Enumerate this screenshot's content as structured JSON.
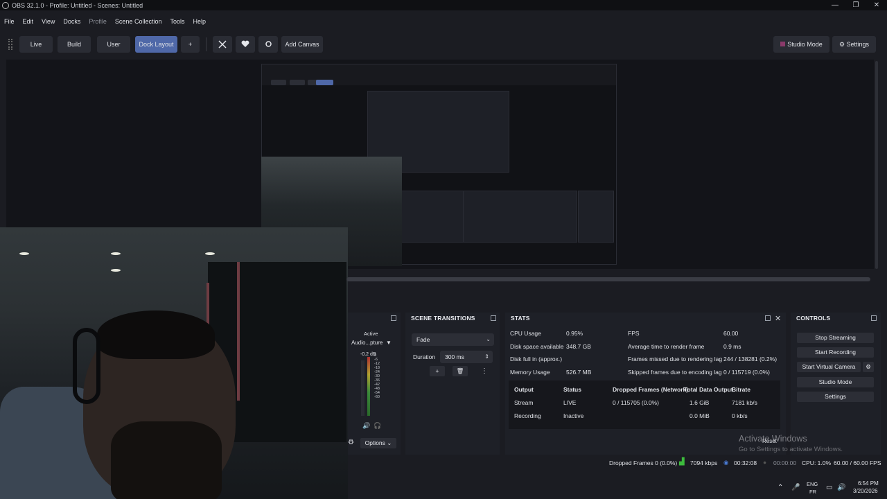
{
  "window": {
    "title": "OBS 32.1.0 - Profile: Untitled - Scenes: Untitled",
    "min": "—",
    "max": "❐",
    "close": "✕"
  },
  "menu": [
    "File",
    "Edit",
    "View",
    "Docks",
    "Profile",
    "Scene Collection",
    "Tools",
    "Help"
  ],
  "toolbar": {
    "live": "Live",
    "build": "Build",
    "user": "User",
    "dock_layout": "Dock Layout",
    "plus": "+",
    "add_canvas": "Add Canvas",
    "studio_mode": "Studio Mode",
    "settings": "Settings"
  },
  "mixer": {
    "active": "Active",
    "source": "Audio...pture",
    "db": "-0.2 dB",
    "ticks": [
      "0",
      "-6",
      "-12",
      "-18",
      "-24",
      "-30",
      "-36",
      "-42",
      "-48",
      "-54",
      "-60"
    ],
    "options": "Options"
  },
  "transitions": {
    "header": "SCENE TRANSITIONS",
    "type": "Fade",
    "duration_label": "Duration",
    "duration": "300 ms"
  },
  "stats": {
    "header": "STATS",
    "left": [
      {
        "label": "CPU Usage",
        "value": "0.95%"
      },
      {
        "label": "Disk space available",
        "value": "348.7 GB"
      },
      {
        "label": "Disk full in (approx.)",
        "value": ""
      },
      {
        "label": "Memory Usage",
        "value": "526.7 MB"
      }
    ],
    "right": [
      {
        "label": "FPS",
        "value": "60.00"
      },
      {
        "label": "Average time to render frame",
        "value": "0.9 ms"
      },
      {
        "label": "Frames missed due to rendering lag",
        "value": "244 / 138281 (0.2%)"
      },
      {
        "label": "Skipped frames due to encoding lag",
        "value": "0 / 115719 (0.0%)"
      }
    ],
    "table_headers": [
      "Output",
      "Status",
      "Dropped Frames (Network)",
      "Total Data Output",
      "Bitrate"
    ],
    "rows": [
      [
        "Stream",
        "LIVE",
        "0 / 115705 (0.0%)",
        "1.6 GiB",
        "7181 kb/s"
      ],
      [
        "Recording",
        "Inactive",
        "",
        "0.0 MiB",
        "0 kb/s"
      ]
    ],
    "reset": "Reset"
  },
  "controls": {
    "header": "CONTROLS",
    "stop_streaming": "Stop Streaming",
    "start_recording": "Start Recording",
    "start_virtual_camera": "Start Virtual Camera",
    "studio_mode": "Studio Mode",
    "settings": "Settings"
  },
  "statusbar": {
    "dropped": "Dropped Frames 0 (0.0%)",
    "kbps": "7094 kbps",
    "live_time": "00:32:08",
    "rec_time": "00:00:00",
    "cpu": "CPU: 1.0%",
    "fps": "60.00 / 60.00 FPS"
  },
  "activate": {
    "title": "Activate Windows",
    "sub": "Go to Settings to activate Windows."
  },
  "taskbar": {
    "lang1": "ENG",
    "lang2": "FR",
    "time": "6:54 PM",
    "date": "3/20/2026"
  }
}
